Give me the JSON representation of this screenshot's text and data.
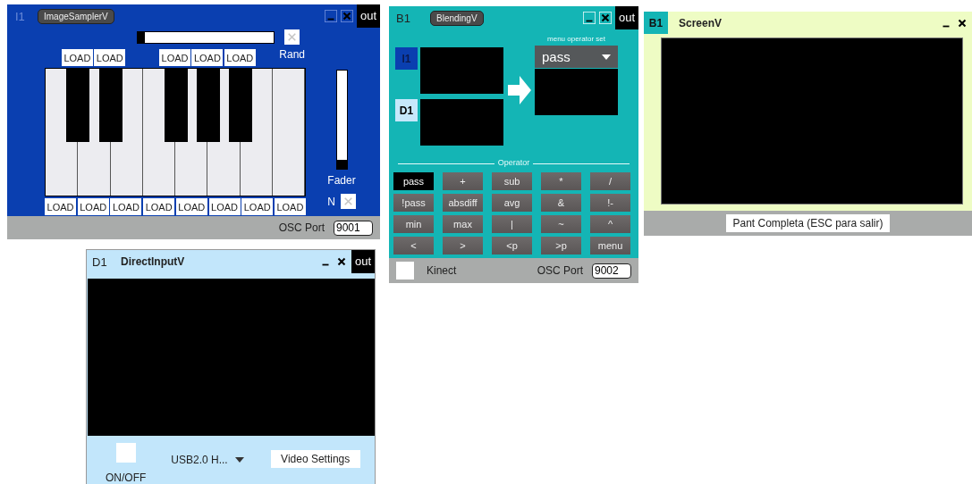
{
  "image_sampler": {
    "id": "I1",
    "title": "ImageSamplerV",
    "out": "out",
    "progress": {
      "level": 0.05
    },
    "rand": {
      "label": "Rand",
      "checked": false
    },
    "white_keys": [
      {
        "load": "LOAD",
        "sharp": {
          "load": "LOAD"
        }
      },
      {
        "load": "LOAD",
        "sharp": {
          "load": "LOAD"
        }
      },
      {
        "load": "LOAD"
      },
      {
        "load": "LOAD",
        "sharp": {
          "load": "LOAD"
        }
      },
      {
        "load": "LOAD",
        "sharp": {
          "load": "LOAD"
        }
      },
      {
        "load": "LOAD",
        "sharp": {
          "load": "LOAD"
        }
      },
      {
        "load": "LOAD"
      },
      {
        "load": "LOAD"
      }
    ],
    "fader": {
      "label": "Fader",
      "level": 0
    },
    "n_toggle": {
      "label": "N",
      "checked": false
    },
    "osc_port": {
      "label": "OSC Port",
      "value": "9001"
    }
  },
  "blending": {
    "id": "B1",
    "title": "BlendingV",
    "out": "out",
    "inputs": [
      {
        "label": "I1",
        "color": "#0a3fb0"
      },
      {
        "label": "D1",
        "color": "#c6e8fb"
      }
    ],
    "menu": {
      "label": "menu operator set",
      "value": "pass"
    },
    "operator_label": "Operator",
    "operators": [
      {
        "label": "pass",
        "selected": true
      },
      {
        "label": "+",
        "selected": false
      },
      {
        "label": "sub",
        "selected": false
      },
      {
        "label": "*",
        "selected": false
      },
      {
        "label": "/",
        "selected": false
      },
      {
        "label": "!pass",
        "selected": false
      },
      {
        "label": "absdiff",
        "selected": false
      },
      {
        "label": "avg",
        "selected": false
      },
      {
        "label": "&",
        "selected": false
      },
      {
        "label": "!-",
        "selected": false
      },
      {
        "label": "min",
        "selected": false
      },
      {
        "label": "max",
        "selected": false
      },
      {
        "label": "|",
        "selected": false
      },
      {
        "label": "~",
        "selected": false
      },
      {
        "label": "^",
        "selected": false
      },
      {
        "label": "<",
        "selected": false
      },
      {
        "label": ">",
        "selected": false
      },
      {
        "label": "<p",
        "selected": false
      },
      {
        "label": ">p",
        "selected": false
      },
      {
        "label": "menu",
        "selected": false
      }
    ],
    "kinect": {
      "label": "Kinect",
      "checked": false
    },
    "osc_port": {
      "label": "OSC Port",
      "value": "9002"
    }
  },
  "screen": {
    "id": "B1",
    "title": "ScreenV",
    "fullscreen_button": "Pant Completa (ESC para salir)"
  },
  "direct_input": {
    "id": "D1",
    "title": "DirectInputV",
    "out": "out",
    "on_off": {
      "label": "ON/OFF",
      "checked": false
    },
    "device": "USB2.0 H...",
    "settings_button": "Video Settings"
  }
}
